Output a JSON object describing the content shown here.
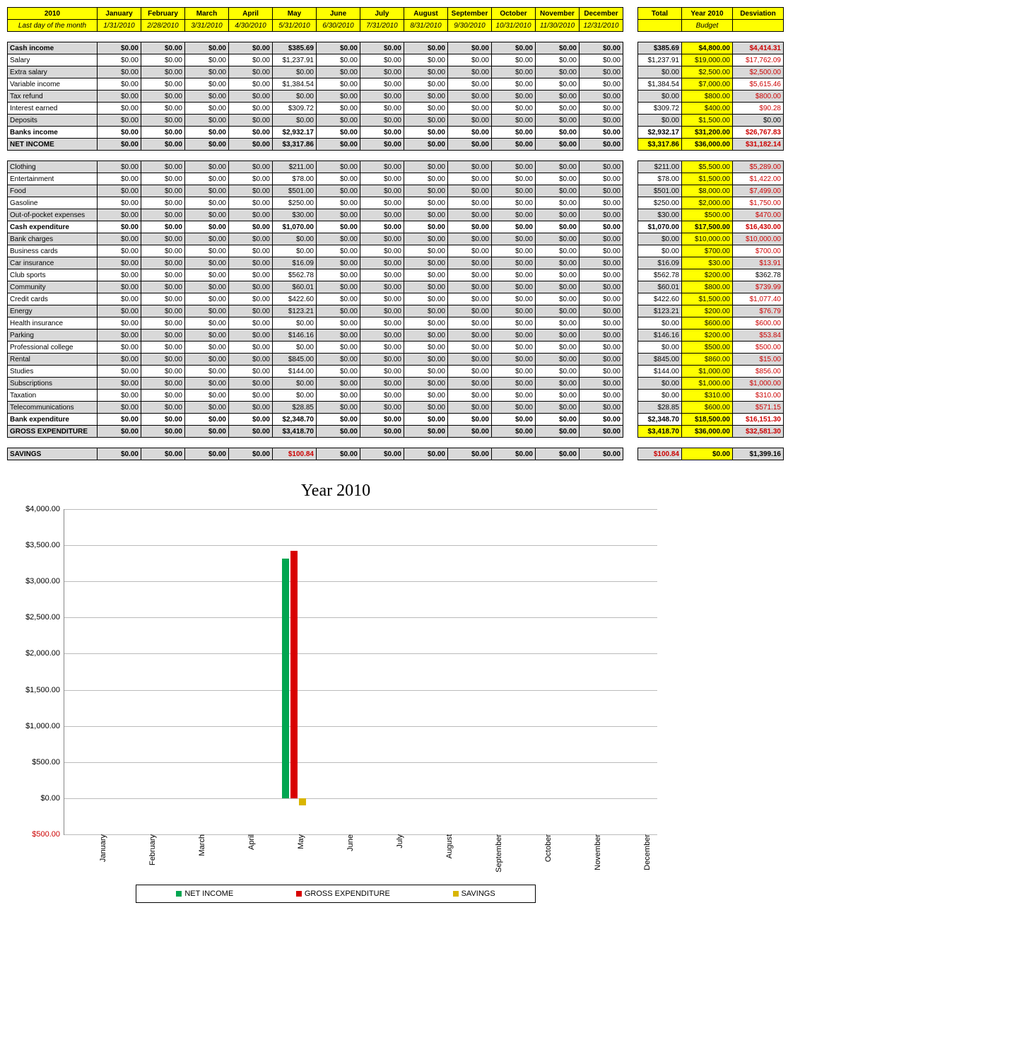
{
  "header": {
    "year": "2010",
    "sub": "Last day of the month",
    "months": [
      "January",
      "February",
      "March",
      "April",
      "May",
      "June",
      "July",
      "August",
      "September",
      "October",
      "November",
      "December"
    ],
    "dates": [
      "1/31/2010",
      "2/28/2010",
      "3/31/2010",
      "4/30/2010",
      "5/31/2010",
      "6/30/2010",
      "7/31/2010",
      "8/31/2010",
      "9/30/2010",
      "10/31/2010",
      "11/30/2010",
      "12/31/2010"
    ],
    "total": "Total",
    "budget_top": "Year 2010",
    "budget_sub": "Budget",
    "desv": "Desviation"
  },
  "sections": [
    {
      "label": "Cash income",
      "may": "$385.69",
      "total": "$385.69",
      "budget": "$4,800.00",
      "desv": "$4,414.31",
      "grey": true,
      "bold": true,
      "budget_red": false
    },
    {
      "label": "Salary",
      "may": "$1,237.91",
      "total": "$1,237.91",
      "budget": "$19,000.00",
      "desv": "$17,762.09",
      "grey": false,
      "bold": false,
      "budget_red": false
    },
    {
      "label": "Extra salary",
      "may": "$0.00",
      "total": "$0.00",
      "budget": "$2,500.00",
      "desv": "$2,500.00",
      "grey": true,
      "bold": false,
      "budget_red": false
    },
    {
      "label": "Variable income",
      "may": "$1,384.54",
      "total": "$1,384.54",
      "budget": "$7,000.00",
      "desv": "$5,615.46",
      "grey": false,
      "bold": false,
      "budget_red": false
    },
    {
      "label": "Tax refund",
      "may": "$0.00",
      "total": "$0.00",
      "budget": "$800.00",
      "desv": "$800.00",
      "grey": true,
      "bold": false,
      "budget_red": false
    },
    {
      "label": "Interest earned",
      "may": "$309.72",
      "total": "$309.72",
      "budget": "$400.00",
      "desv": "$90.28",
      "grey": false,
      "bold": false,
      "budget_red": false
    },
    {
      "label": "Deposits",
      "may": "$0.00",
      "total": "$0.00",
      "budget": "$1,500.00",
      "desv": "$0.00",
      "grey": true,
      "bold": false,
      "budget_red": false,
      "desv_black": true
    },
    {
      "label": "Banks income",
      "may": "$2,932.17",
      "total": "$2,932.17",
      "budget": "$31,200.00",
      "desv": "$26,767.83",
      "grey": false,
      "bold": true,
      "budget_red": false
    },
    {
      "label": "NET INCOME",
      "may": "$3,317.86",
      "total": "$3,317.86",
      "budget": "$36,000.00",
      "desv": "$31,182.14",
      "grey": true,
      "bold": true,
      "budget_red": false,
      "total_yellow": true
    }
  ],
  "exp": [
    {
      "label": "Clothing",
      "may": "$211.00",
      "total": "$211.00",
      "budget": "$5,500.00",
      "desv": "$5,289.00",
      "grey": true
    },
    {
      "label": "Entertainment",
      "may": "$78.00",
      "total": "$78.00",
      "budget": "$1,500.00",
      "desv": "$1,422.00",
      "grey": false
    },
    {
      "label": "Food",
      "may": "$501.00",
      "total": "$501.00",
      "budget": "$8,000.00",
      "desv": "$7,499.00",
      "grey": true
    },
    {
      "label": "Gasoline",
      "may": "$250.00",
      "total": "$250.00",
      "budget": "$2,000.00",
      "desv": "$1,750.00",
      "grey": false
    },
    {
      "label": "Out-of-pocket expenses",
      "may": "$30.00",
      "total": "$30.00",
      "budget": "$500.00",
      "desv": "$470.00",
      "grey": true
    },
    {
      "label": "Cash expenditure",
      "may": "$1,070.00",
      "total": "$1,070.00",
      "budget": "$17,500.00",
      "desv": "$16,430.00",
      "grey": false,
      "bold": true
    },
    {
      "label": "Bank charges",
      "may": "$0.00",
      "total": "$0.00",
      "budget": "$10,000.00",
      "desv": "$10,000.00",
      "grey": true
    },
    {
      "label": "Business cards",
      "may": "$0.00",
      "total": "$0.00",
      "budget": "$700.00",
      "desv": "$700.00",
      "grey": false
    },
    {
      "label": "Car insurance",
      "may": "$16.09",
      "total": "$16.09",
      "budget": "$30.00",
      "desv": "$13.91",
      "grey": true
    },
    {
      "label": "Club sports",
      "may": "$562.78",
      "total": "$562.78",
      "budget": "$200.00",
      "desv": "$362.78",
      "grey": false,
      "desv_black": true
    },
    {
      "label": "Community",
      "may": "$60.01",
      "total": "$60.01",
      "budget": "$800.00",
      "desv": "$739.99",
      "grey": true
    },
    {
      "label": "Credit cards",
      "may": "$422.60",
      "total": "$422.60",
      "budget": "$1,500.00",
      "desv": "$1,077.40",
      "grey": false
    },
    {
      "label": "Energy",
      "may": "$123.21",
      "total": "$123.21",
      "budget": "$200.00",
      "desv": "$76.79",
      "grey": true
    },
    {
      "label": "Health insurance",
      "may": "$0.00",
      "total": "$0.00",
      "budget": "$600.00",
      "desv": "$600.00",
      "grey": false
    },
    {
      "label": "Parking",
      "may": "$146.16",
      "total": "$146.16",
      "budget": "$200.00",
      "desv": "$53.84",
      "grey": true
    },
    {
      "label": "Professional college",
      "may": "$0.00",
      "total": "$0.00",
      "budget": "$500.00",
      "desv": "$500.00",
      "grey": false
    },
    {
      "label": "Rental",
      "may": "$845.00",
      "total": "$845.00",
      "budget": "$860.00",
      "desv": "$15.00",
      "grey": true
    },
    {
      "label": "Studies",
      "may": "$144.00",
      "total": "$144.00",
      "budget": "$1,000.00",
      "desv": "$856.00",
      "grey": false
    },
    {
      "label": "Subscriptions",
      "may": "$0.00",
      "total": "$0.00",
      "budget": "$1,000.00",
      "desv": "$1,000.00",
      "grey": true
    },
    {
      "label": "Taxation",
      "may": "$0.00",
      "total": "$0.00",
      "budget": "$310.00",
      "desv": "$310.00",
      "grey": false
    },
    {
      "label": "Telecommunications",
      "may": "$28.85",
      "total": "$28.85",
      "budget": "$600.00",
      "desv": "$571.15",
      "grey": true
    },
    {
      "label": "Bank expenditure",
      "may": "$2,348.70",
      "total": "$2,348.70",
      "budget": "$18,500.00",
      "desv": "$16,151.30",
      "grey": false,
      "bold": true
    },
    {
      "label": "GROSS EXPENDITURE",
      "may": "$3,418.70",
      "total": "$3,418.70",
      "budget": "$36,000.00",
      "desv": "$32,581.30",
      "grey": true,
      "bold": true,
      "total_yellow": true
    }
  ],
  "savings": {
    "label": "SAVINGS",
    "may": "$100.84",
    "total": "$100.84",
    "budget": "$0.00",
    "desv": "$1,399.16"
  },
  "zero": "$0.00",
  "chart_data": {
    "type": "bar",
    "title": "Year 2010",
    "categories": [
      "January",
      "February",
      "March",
      "April",
      "May",
      "June",
      "July",
      "August",
      "September",
      "October",
      "November",
      "December"
    ],
    "series": [
      {
        "name": "NET INCOME",
        "color": "#00a651",
        "values": [
          0,
          0,
          0,
          0,
          3317.86,
          0,
          0,
          0,
          0,
          0,
          0,
          0
        ]
      },
      {
        "name": "GROSS EXPENDITURE",
        "color": "#d80000",
        "values": [
          0,
          0,
          0,
          0,
          3418.7,
          0,
          0,
          0,
          0,
          0,
          0,
          0
        ]
      },
      {
        "name": "SAVINGS",
        "color": "#d9b500",
        "values": [
          0,
          0,
          0,
          0,
          -100.84,
          0,
          0,
          0,
          0,
          0,
          0,
          0
        ]
      }
    ],
    "ylim": [
      -500,
      4000
    ],
    "yticks": [
      -500,
      0,
      500,
      1000,
      1500,
      2000,
      2500,
      3000,
      3500,
      4000
    ],
    "ytick_labels": [
      "$500.00",
      "$0.00",
      "$500.00",
      "$1,000.00",
      "$1,500.00",
      "$2,000.00",
      "$2,500.00",
      "$3,000.00",
      "$3,500.00",
      "$4,000.00"
    ]
  }
}
